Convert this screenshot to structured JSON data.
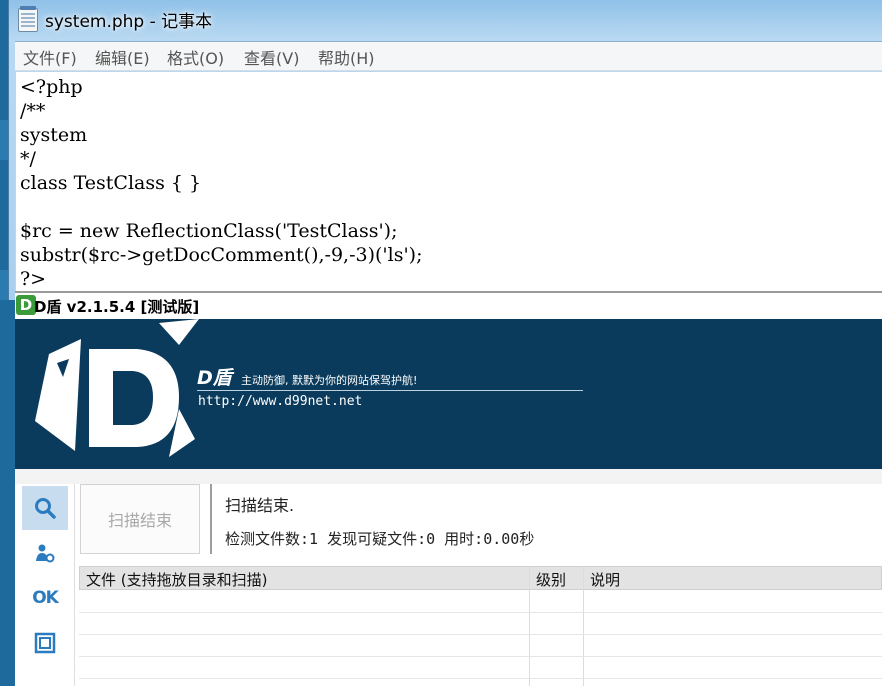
{
  "notepad": {
    "title": "system.php - 记事本",
    "menu": [
      "文件(F)",
      "编辑(E)",
      "格式(O)",
      "查看(V)",
      "帮助(H)"
    ],
    "code_lines": [
      "<?php",
      "/**",
      "system",
      "*/",
      "class TestClass { }",
      "",
      "$rc = new ReflectionClass('TestClass');",
      "substr($rc->getDocComment(),-9,-3)('ls');",
      "?>"
    ]
  },
  "dshield": {
    "title": "D盾 v2.1.5.4 [测试版]",
    "logo_small_letter": "D",
    "banner": {
      "brand": "D盾",
      "slogan": "主动防御, 默默为你的网站保驾护航!",
      "url": "http://www.d99net.net"
    },
    "sidebar": {
      "items": [
        "search-icon",
        "user-icon",
        "OK",
        "window-icon"
      ],
      "ok_label": "OK"
    },
    "scan_button": "扫描结束",
    "status_line1": "扫描结束.",
    "status_line2": "检测文件数:1 发现可疑文件:0 用时:0.00秒",
    "table": {
      "columns": [
        "文件 (支持拖放目录和扫描)",
        "级别",
        "说明"
      ],
      "rows": []
    },
    "colors": {
      "banner_bg": "#0a3b5c",
      "accent": "#2b7bc0",
      "logo_green": "#3d9a3a"
    }
  }
}
